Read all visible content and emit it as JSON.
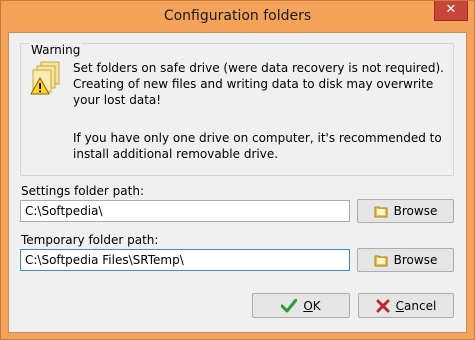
{
  "window": {
    "title": "Configuration folders",
    "close_glyph": "✕"
  },
  "warning": {
    "group_label": "Warning",
    "icon": "folders-warning-icon",
    "paragraph1": "Set folders on safe drive (were data recovery is not required). Creating of new files and writing data to disk may overwrite your lost data!",
    "paragraph2": "If you have only one drive on computer, it's recommended to install additional removable drive."
  },
  "settings_folder": {
    "label": "Settings folder path:",
    "value": "C:\\Softpedia\\",
    "browse_label": "Browse"
  },
  "temp_folder": {
    "label": "Temporary folder path:",
    "value": "C:\\Softpedia Files\\SRTemp\\",
    "browse_label": "Browse"
  },
  "buttons": {
    "ok_first": "O",
    "ok_rest": "K",
    "cancel_first": "C",
    "cancel_rest": "ancel"
  },
  "colors": {
    "frame": "#f5a35a",
    "close_button": "#c7463a",
    "ok_icon": "#2e9b2e",
    "cancel_icon": "#c0282d",
    "folder_icon": "#e8c04a"
  }
}
